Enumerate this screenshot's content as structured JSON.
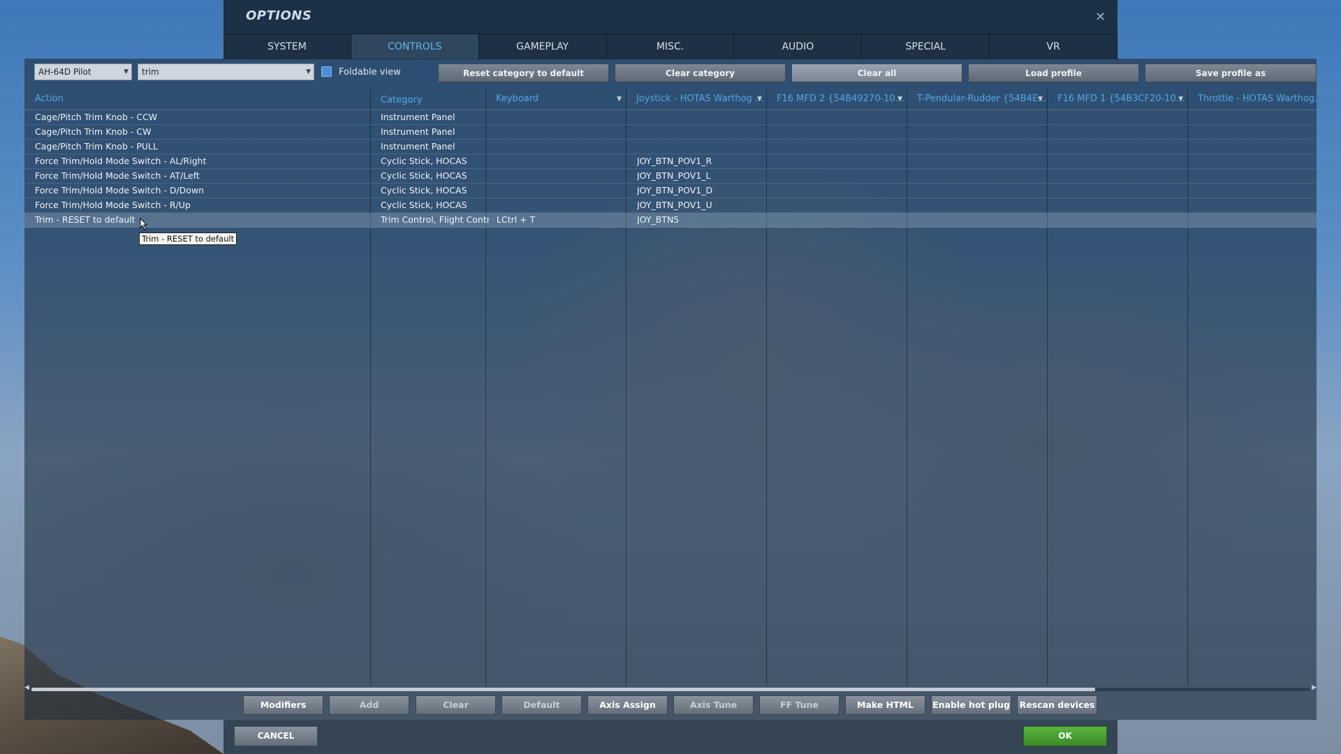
{
  "window": {
    "title": "OPTIONS"
  },
  "tabs": [
    {
      "label": "SYSTEM"
    },
    {
      "label": "CONTROLS",
      "active": true
    },
    {
      "label": "GAMEPLAY"
    },
    {
      "label": "MISC."
    },
    {
      "label": "AUDIO"
    },
    {
      "label": "SPECIAL"
    },
    {
      "label": "VR"
    }
  ],
  "toolbar": {
    "aircraft_select": "AH-64D Pilot",
    "search_value": "trim",
    "foldable_label": "Foldable view",
    "foldable_checked": true,
    "reset_category": "Reset category to default",
    "clear_category": "Clear category",
    "clear_all": "Clear all",
    "load_profile": "Load profile",
    "save_profile": "Save profile as"
  },
  "columns": {
    "action": "Action",
    "category": "Category",
    "keyboard": "Keyboard",
    "joystick": "Joystick - HOTAS Warthog ...",
    "mfd2": "F16 MFD 2 {54B49270-10...",
    "rudder": "T-Pendular-Rudder {54B4E...",
    "mfd1": "F16 MFD 1 {54B3CF20-10...",
    "throttle": "Throttle - HOTAS Warthog..."
  },
  "rows": [
    {
      "action": "Cage/Pitch Trim Knob - CCW",
      "category": "Instrument Panel",
      "keyboard": "",
      "joystick": ""
    },
    {
      "action": "Cage/Pitch Trim Knob - CW",
      "category": "Instrument Panel",
      "keyboard": "",
      "joystick": ""
    },
    {
      "action": "Cage/Pitch Trim Knob - PULL",
      "category": "Instrument Panel",
      "keyboard": "",
      "joystick": ""
    },
    {
      "action": "Force Trim/Hold Mode Switch - AL/Right",
      "category": "Cyclic Stick, HOCAS",
      "keyboard": "",
      "joystick": "JOY_BTN_POV1_R"
    },
    {
      "action": "Force Trim/Hold Mode Switch - AT/Left",
      "category": "Cyclic Stick, HOCAS",
      "keyboard": "",
      "joystick": "JOY_BTN_POV1_L"
    },
    {
      "action": "Force Trim/Hold Mode Switch - D/Down",
      "category": "Cyclic Stick, HOCAS",
      "keyboard": "",
      "joystick": "JOY_BTN_POV1_D"
    },
    {
      "action": "Force Trim/Hold Mode Switch - R/Up",
      "category": "Cyclic Stick, HOCAS",
      "keyboard": "",
      "joystick": "JOY_BTN_POV1_U"
    },
    {
      "action": "Trim - RESET to default",
      "category": "Trim Control, Flight Control",
      "keyboard": "LCtrl + T",
      "joystick": "JOY_BTN5",
      "selected": true
    }
  ],
  "tooltip": "Trim - RESET to default",
  "bottom_buttons": {
    "modifiers": "Modifiers",
    "add": "Add",
    "clear": "Clear",
    "default": "Default",
    "axis_assign": "Axis Assign",
    "axis_tune": "Axis Tune",
    "ff_tune": "FF Tune",
    "make_html": "Make HTML",
    "hot_plug": "Enable hot plug",
    "rescan": "Rescan devices"
  },
  "footer": {
    "cancel": "CANCEL",
    "ok": "OK"
  },
  "colors": {
    "accent": "#4fa8e6",
    "ok_green": "#4a9e30",
    "checkbox": "#4a8fd8"
  }
}
